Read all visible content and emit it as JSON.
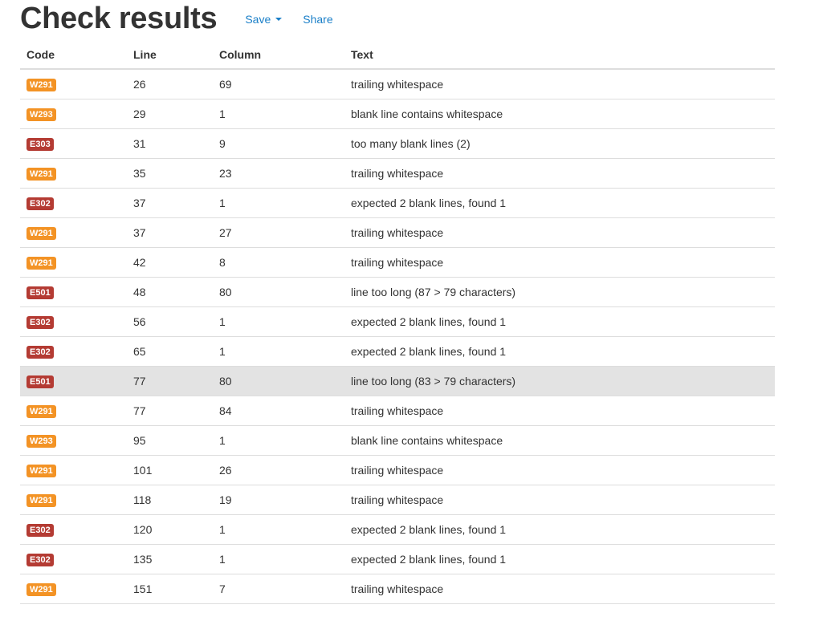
{
  "header": {
    "title": "Check results",
    "save_label": "Save",
    "share_label": "Share"
  },
  "colors": {
    "warning_badge": "#f39325",
    "error_badge": "#b43b33",
    "link": "#1a7fc8",
    "selected_row": "#e3e3e3"
  },
  "table": {
    "columns": [
      "Code",
      "Line",
      "Column",
      "Text"
    ],
    "rows": [
      {
        "code": "W291",
        "severity": "warning",
        "line": "26",
        "column": "69",
        "text": "trailing whitespace"
      },
      {
        "code": "W293",
        "severity": "warning",
        "line": "29",
        "column": "1",
        "text": "blank line contains whitespace"
      },
      {
        "code": "E303",
        "severity": "error",
        "line": "31",
        "column": "9",
        "text": "too many blank lines (2)"
      },
      {
        "code": "W291",
        "severity": "warning",
        "line": "35",
        "column": "23",
        "text": "trailing whitespace"
      },
      {
        "code": "E302",
        "severity": "error",
        "line": "37",
        "column": "1",
        "text": "expected 2 blank lines, found 1"
      },
      {
        "code": "W291",
        "severity": "warning",
        "line": "37",
        "column": "27",
        "text": "trailing whitespace"
      },
      {
        "code": "W291",
        "severity": "warning",
        "line": "42",
        "column": "8",
        "text": "trailing whitespace"
      },
      {
        "code": "E501",
        "severity": "error",
        "line": "48",
        "column": "80",
        "text": "line too long (87 > 79 characters)"
      },
      {
        "code": "E302",
        "severity": "error",
        "line": "56",
        "column": "1",
        "text": "expected 2 blank lines, found 1"
      },
      {
        "code": "E302",
        "severity": "error",
        "line": "65",
        "column": "1",
        "text": "expected 2 blank lines, found 1"
      },
      {
        "code": "E501",
        "severity": "error",
        "line": "77",
        "column": "80",
        "text": "line too long (83 > 79 characters)",
        "selected": true
      },
      {
        "code": "W291",
        "severity": "warning",
        "line": "77",
        "column": "84",
        "text": "trailing whitespace"
      },
      {
        "code": "W293",
        "severity": "warning",
        "line": "95",
        "column": "1",
        "text": "blank line contains whitespace"
      },
      {
        "code": "W291",
        "severity": "warning",
        "line": "101",
        "column": "26",
        "text": "trailing whitespace"
      },
      {
        "code": "W291",
        "severity": "warning",
        "line": "118",
        "column": "19",
        "text": "trailing whitespace"
      },
      {
        "code": "E302",
        "severity": "error",
        "line": "120",
        "column": "1",
        "text": "expected 2 blank lines, found 1"
      },
      {
        "code": "E302",
        "severity": "error",
        "line": "135",
        "column": "1",
        "text": "expected 2 blank lines, found 1"
      },
      {
        "code": "W291",
        "severity": "warning",
        "line": "151",
        "column": "7",
        "text": "trailing whitespace"
      }
    ]
  }
}
